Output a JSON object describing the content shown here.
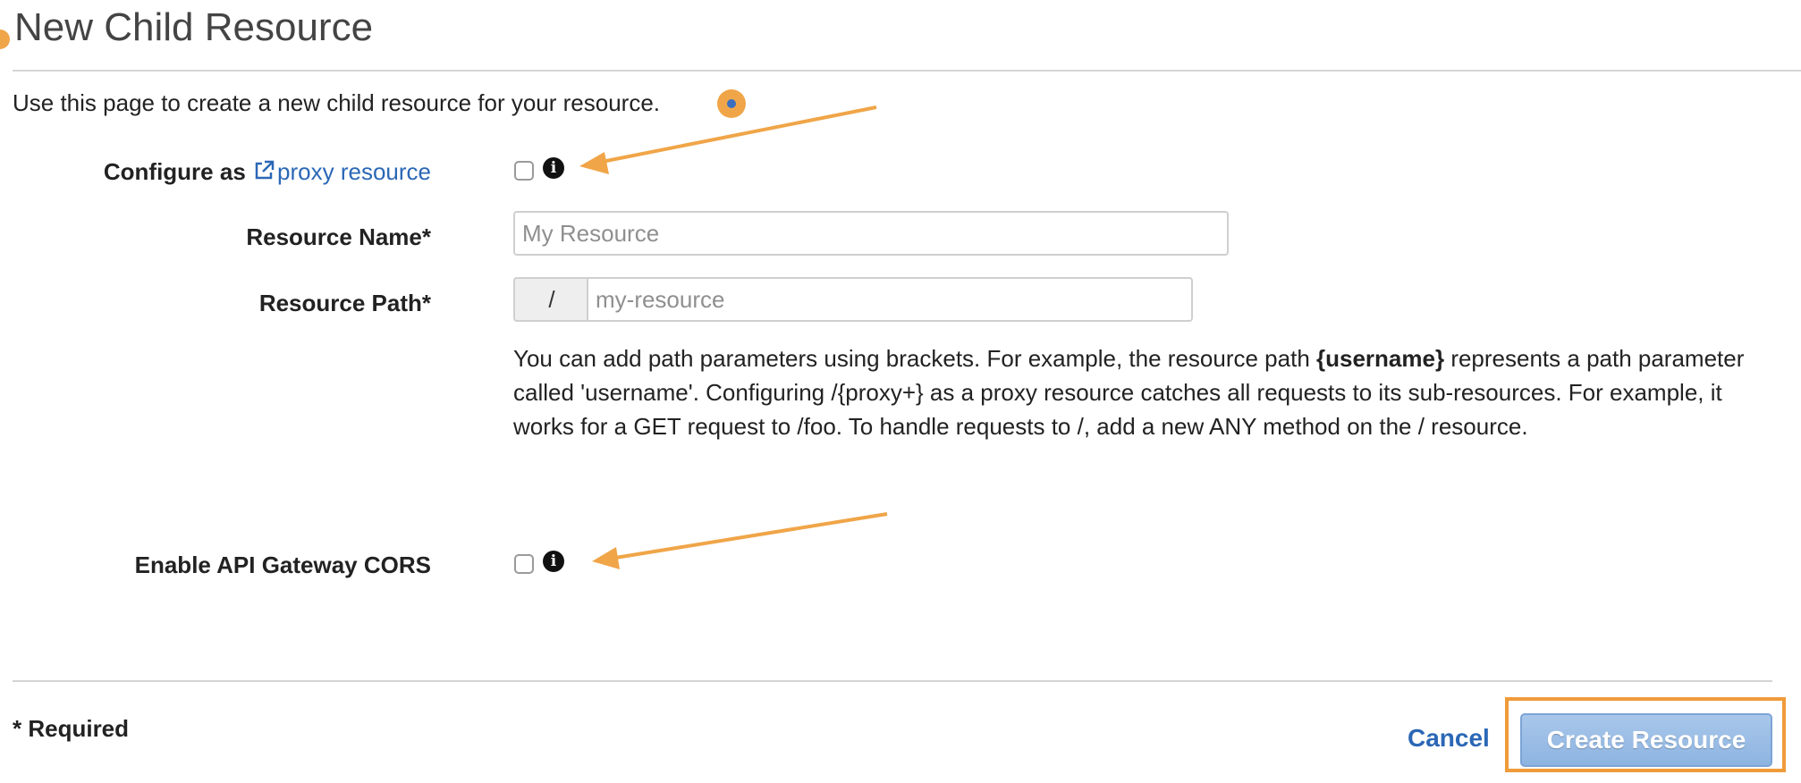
{
  "page": {
    "title": "New Child Resource",
    "intro": "Use this page to create a new child resource for your resource."
  },
  "form": {
    "proxy": {
      "label_prefix": "Configure as",
      "link_text": "proxy resource",
      "checked": false
    },
    "resource_name": {
      "label": "Resource Name*",
      "placeholder": "My Resource",
      "value": ""
    },
    "resource_path": {
      "label": "Resource Path*",
      "prefix": "/",
      "placeholder": "my-resource",
      "value": ""
    },
    "help": {
      "part1": "You can add path parameters using brackets. For example, the resource path ",
      "param": "{username}",
      "part2": " represents a path parameter called 'username'. Configuring /{proxy+} as a proxy resource catches all requests to its sub-resources. For example, it works for a GET request to /foo. To handle requests to /, add a new ANY method on the / resource."
    },
    "cors": {
      "label": "Enable API Gateway CORS",
      "checked": false
    }
  },
  "footer": {
    "required_note": "* Required",
    "cancel_label": "Cancel",
    "create_label": "Create Resource"
  },
  "icons": {
    "info": "info-circle-icon",
    "external_link": "external-link-icon"
  },
  "colors": {
    "link": "#2b67b6",
    "annotation_orange": "#f0a548",
    "primary_button": "#9bbde6"
  }
}
